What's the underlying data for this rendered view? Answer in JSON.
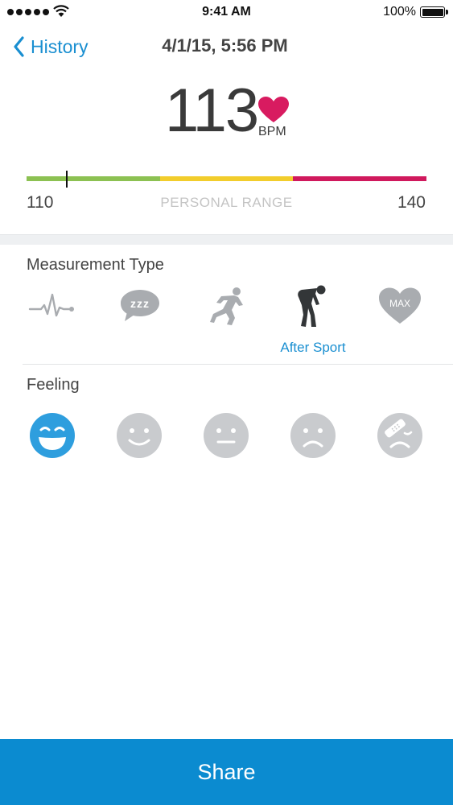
{
  "status_bar": {
    "time": "9:41 AM",
    "battery_percent": "100%",
    "battery_level": 1.0
  },
  "nav": {
    "back_label": "History",
    "title": "4/1/15, 5:56 PM"
  },
  "reading": {
    "value": "113",
    "unit": "BPM",
    "heart_color": "#d81b60"
  },
  "range": {
    "min": "110",
    "max": "140",
    "caption": "PERSONAL RANGE",
    "min_value": 110,
    "max_value": 140,
    "current_value": 113,
    "zones": [
      {
        "color": "#8cc152"
      },
      {
        "color": "#f2cd2c"
      },
      {
        "color": "#d0195d"
      }
    ]
  },
  "measurement_type": {
    "label": "Measurement Type",
    "items": [
      {
        "name": "resting-pulse",
        "icon": "pulse-line-icon"
      },
      {
        "name": "sleeping",
        "icon": "sleep-bubble-icon"
      },
      {
        "name": "before-sport",
        "icon": "runner-start-icon"
      },
      {
        "name": "after-sport",
        "icon": "tired-runner-icon",
        "caption": "After Sport"
      },
      {
        "name": "max",
        "icon": "max-heart-icon",
        "badge": "MAX"
      }
    ],
    "selected_index": 3
  },
  "feeling": {
    "label": "Feeling",
    "items": [
      {
        "name": "very-happy",
        "icon": "big-smile-face-icon"
      },
      {
        "name": "happy",
        "icon": "smile-face-icon"
      },
      {
        "name": "neutral",
        "icon": "neutral-face-icon"
      },
      {
        "name": "sad",
        "icon": "sad-face-icon"
      },
      {
        "name": "injured",
        "icon": "bandaged-face-icon"
      }
    ],
    "selected_index": 0
  },
  "share": {
    "label": "Share"
  },
  "colors": {
    "accent": "#1a8fd1",
    "inactive_icon": "#a9acb0",
    "selected_icon": "#333638",
    "selected_face": "#2e9ede",
    "inactive_face": "#c9cbce"
  }
}
